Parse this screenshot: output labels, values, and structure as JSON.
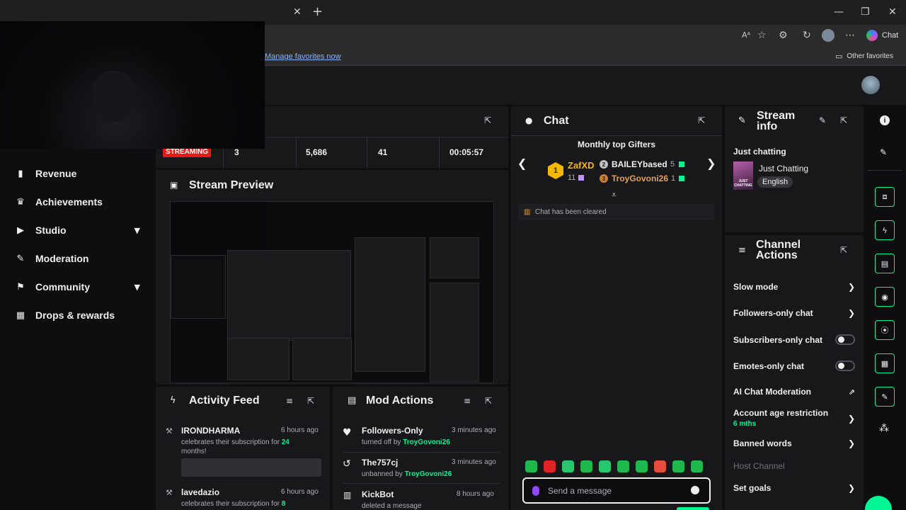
{
  "browser": {
    "close_tab": "✕",
    "new_tab": "+",
    "window_controls": [
      "—",
      "❐",
      "✕"
    ],
    "toolbar_icons": [
      "read-aloud-icon",
      "favorite-star-icon",
      "extensions-icon",
      "history-icon",
      "profile-icon",
      "more-icon"
    ],
    "copilot_label": "Chat",
    "favorites_link": "Manage favorites now",
    "other_favorites": "Other favorites"
  },
  "sidebar": {
    "items": [
      {
        "label": "Revenue",
        "icon": "revenue-icon",
        "glyph": "▮"
      },
      {
        "label": "Achievements",
        "icon": "trophy-icon",
        "glyph": "♛"
      },
      {
        "label": "Studio",
        "icon": "studio-icon",
        "glyph": "▶",
        "expand": true
      },
      {
        "label": "Moderation",
        "icon": "wrench-icon",
        "glyph": "✎"
      },
      {
        "label": "Community",
        "icon": "community-icon",
        "glyph": "⚑",
        "expand": true
      },
      {
        "label": "Drops & rewards",
        "icon": "drops-icon",
        "glyph": "▦"
      }
    ]
  },
  "stats": {
    "badge": "STREAMING",
    "values": [
      "3",
      "5,686",
      "41",
      "00:05:57"
    ]
  },
  "preview": {
    "title": "Stream Preview"
  },
  "activity": {
    "title": "Activity Feed",
    "items": [
      {
        "name": "IRONDHARMA",
        "time": "6 hours ago",
        "text": "celebrates their subscription for",
        "highlight": "24",
        "text2": "months!"
      },
      {
        "name": "lavedazio",
        "time": "6 hours ago",
        "text": "celebrates their subscription for",
        "highlight": "8"
      }
    ]
  },
  "modactions": {
    "title": "Mod Actions",
    "items": [
      {
        "name": "Followers-Only",
        "time": "3 minutes ago",
        "text": "turned off by",
        "user": "TroyGovoni26",
        "icon": "heart-icon",
        "glyph": "♥"
      },
      {
        "name": "The757cj",
        "time": "3 minutes ago",
        "text": "unbanned by",
        "user": "TroyGovoni26",
        "icon": "undo-icon",
        "glyph": "↺"
      },
      {
        "name": "KickBot",
        "time": "8 hours ago",
        "text": "deleted a message",
        "user": "",
        "icon": "trash-icon",
        "glyph": "🗑"
      }
    ]
  },
  "chat": {
    "title": "Chat",
    "gifters_title": "Monthly top Gifters",
    "top": {
      "rank": "1",
      "name": "ZafXD",
      "count": "11"
    },
    "second": {
      "rank": "2",
      "name": "BAILEYbased",
      "count": "5"
    },
    "third": {
      "rank": "3",
      "name": "TroyGovoni26",
      "count": "1"
    },
    "cleared": "Chat has been cleared",
    "input_placeholder": "Send a message",
    "emote_count": 10
  },
  "stream_info": {
    "title": "Stream info",
    "stream_title": "Just chatting",
    "category": "Just Chatting",
    "language": "English",
    "category_thumb_text": "JUST CHATTING"
  },
  "channel_actions": {
    "title": "Channel Actions",
    "slow_mode": "Slow mode",
    "followers_only": "Followers-only chat",
    "subscribers_only": "Subscribers-only chat",
    "emotes_only": "Emotes-only chat",
    "ai_moderation": "AI Chat Moderation",
    "account_age": "Account age restriction",
    "account_age_value": "6 mths",
    "banned_words": "Banned words",
    "host_channel": "Host Channel",
    "set_goals": "Set goals"
  },
  "rail": [
    "info-icon",
    "edit-icon",
    "screen-icon",
    "lightning-icon",
    "notes-icon",
    "chat-bubble-icon",
    "broadcast-icon",
    "layout-icon",
    "wrench-icon",
    "apps-icon"
  ],
  "colors": {
    "accent": "#00f593",
    "live": "#e91916",
    "gold": "#f5b700",
    "bg": "#0e0e10",
    "panel": "#18181b"
  }
}
